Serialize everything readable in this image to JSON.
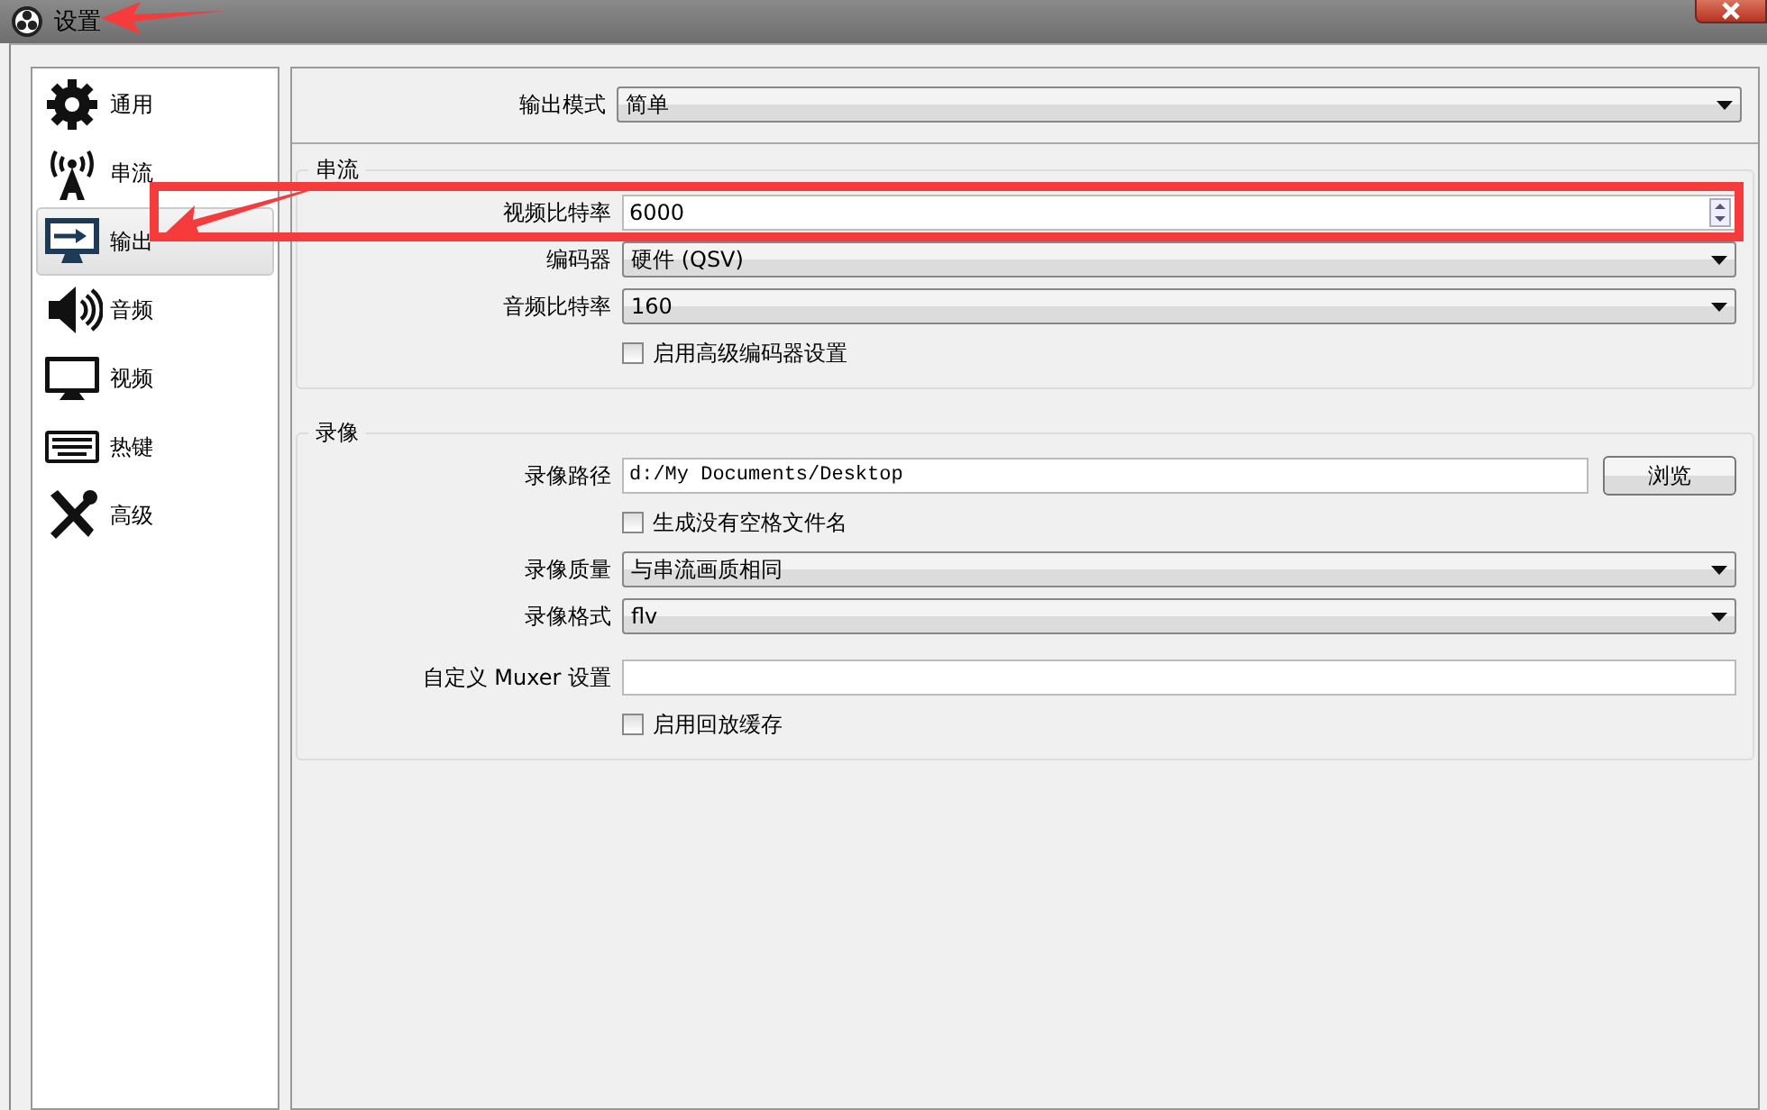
{
  "window": {
    "title": "设置"
  },
  "sidebar": {
    "items": [
      {
        "label": "通用",
        "selected": false
      },
      {
        "label": "串流",
        "selected": false
      },
      {
        "label": "输出",
        "selected": true
      },
      {
        "label": "音频",
        "selected": false
      },
      {
        "label": "视频",
        "selected": false
      },
      {
        "label": "热键",
        "selected": false
      },
      {
        "label": "高级",
        "selected": false
      }
    ]
  },
  "top": {
    "rows": [
      {
        "kind": "select",
        "label": "输出模式",
        "value": "简单"
      }
    ]
  },
  "groups": [
    {
      "title": "串流",
      "rows": [
        {
          "kind": "spin",
          "label": "视频比特率",
          "value": "6000",
          "annotated": true
        },
        {
          "kind": "select",
          "label": "编码器",
          "value": "硬件 (QSV)"
        },
        {
          "kind": "select",
          "label": "音频比特率",
          "value": "160"
        },
        {
          "kind": "checkbox",
          "label": "启用高级编码器设置",
          "checked": false
        }
      ]
    },
    {
      "title": "录像",
      "rows": [
        {
          "kind": "path",
          "label": "录像路径",
          "value": "d:/My Documents/Desktop",
          "button": "浏览"
        },
        {
          "kind": "checkbox",
          "label": "生成没有空格文件名",
          "checked": false
        },
        {
          "kind": "select",
          "label": "录像质量",
          "value": "与串流画质相同"
        },
        {
          "kind": "select",
          "label": "录像格式",
          "value": "flv"
        },
        {
          "kind": "text",
          "label": "自定义 Muxer 设置"
        },
        {
          "kind": "checkbox",
          "label": "启用回放缓存",
          "checked": false
        }
      ]
    }
  ]
}
